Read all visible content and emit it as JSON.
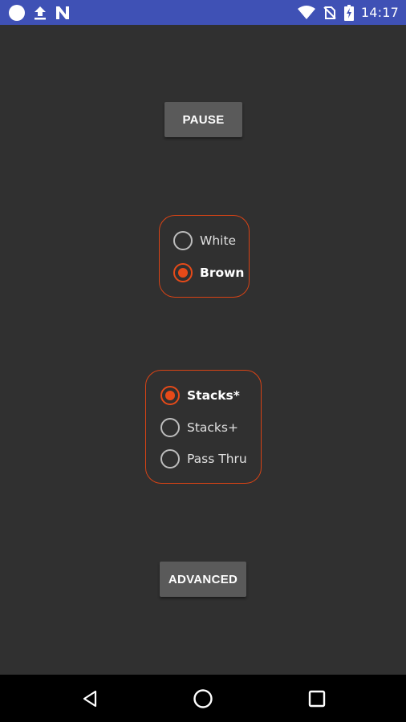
{
  "status_bar": {
    "time": "14:17",
    "left_icons": [
      "circle-notification-icon",
      "upload-icon",
      "n-notification-icon"
    ],
    "right_icons": [
      "wifi-icon",
      "no-sim-icon",
      "battery-charging-icon"
    ],
    "background": "#3f51b5"
  },
  "main": {
    "pause_label": "PAUSE",
    "color_options": [
      {
        "label": "White",
        "selected": false
      },
      {
        "label": "Brown",
        "selected": true
      }
    ],
    "mode_options": [
      {
        "label": "Stacks*",
        "selected": true
      },
      {
        "label": "Stacks+",
        "selected": false
      },
      {
        "label": "Pass Thru",
        "selected": false
      }
    ],
    "advanced_label": "ADVANCED"
  },
  "nav_bar": {
    "buttons": [
      "back-icon",
      "home-icon",
      "recents-icon"
    ]
  },
  "colors": {
    "accent": "#e64a19",
    "background": "#303030",
    "button": "#5a5a5a"
  }
}
